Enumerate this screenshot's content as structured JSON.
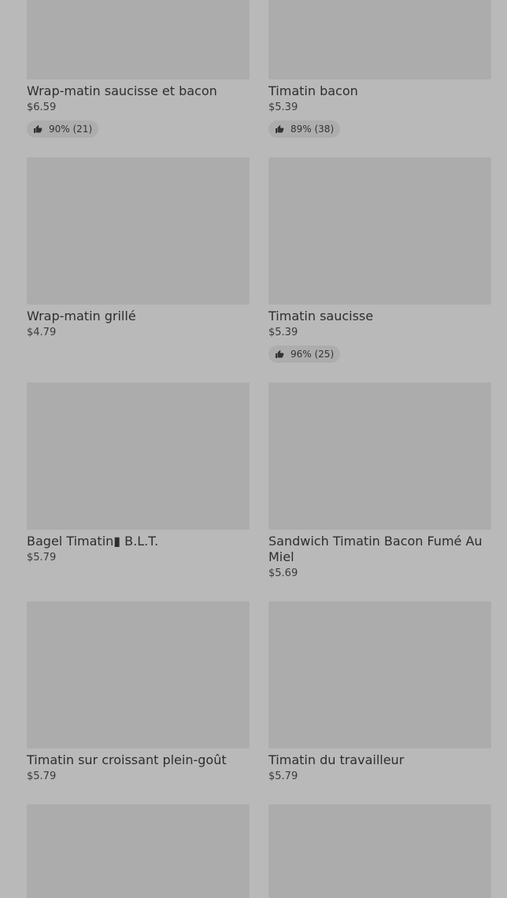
{
  "items": [
    {
      "name": "Wrap-matin saucisse et bacon",
      "price": "$6.59",
      "rating": "90% (21)"
    },
    {
      "name": "Timatin bacon",
      "price": "$5.39",
      "rating": "89% (38)"
    },
    {
      "name": "Wrap-matin grillé",
      "price": "$4.79"
    },
    {
      "name": "Timatin saucisse",
      "price": "$5.39",
      "rating": "96% (25)"
    },
    {
      "name": "Bagel Timatin▮ B.L.T.",
      "price": "$5.79"
    },
    {
      "name": "Sandwich Timatin Bacon Fumé Au Miel",
      "price": "$5.69"
    },
    {
      "name": "Timatin sur croissant plein-goût",
      "price": "$5.79"
    },
    {
      "name": "Timatin du travailleur",
      "price": "$5.79"
    },
    {
      "name": "",
      "price": ""
    },
    {
      "name": "",
      "price": ""
    }
  ],
  "icons": {
    "rating": "thumbs-up-icon"
  },
  "colors": {
    "background": "#b9b9b9",
    "image_placeholder": "#acacac",
    "rating_pill": "#adadad"
  }
}
